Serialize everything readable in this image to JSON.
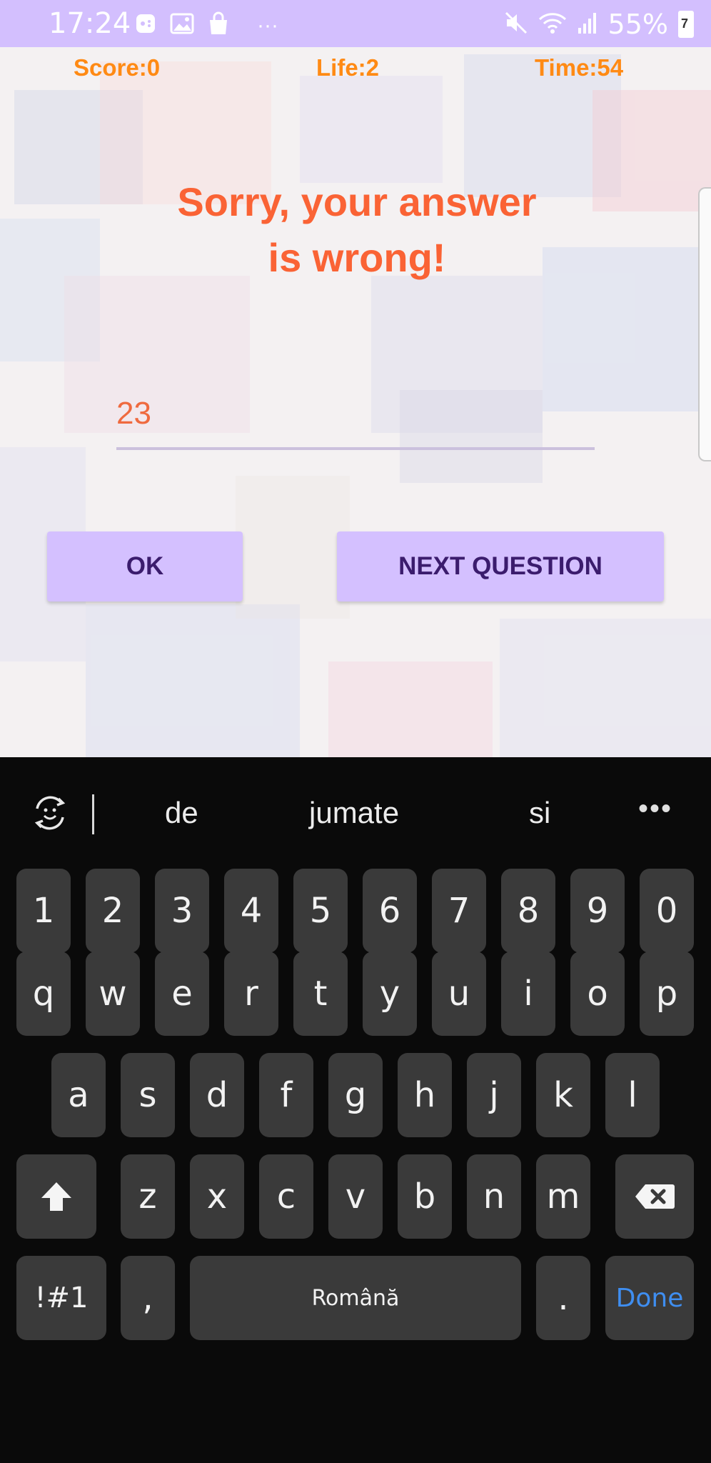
{
  "status_bar": {
    "time": "17:24",
    "notification_icons": [
      "game-icon",
      "image-icon",
      "shopping-bag-icon",
      "more-dots-icon"
    ],
    "more_glyph": "···",
    "battery_percent": "55%",
    "right_icons": [
      "mute-icon",
      "wifi-icon",
      "signal-icon",
      "battery-icon"
    ]
  },
  "hud": {
    "score": "Score:0",
    "life": "Life:2",
    "time": "Time:54",
    "color": "#ff8a14"
  },
  "message": {
    "line1": "Sorry, your answer",
    "line2": "is wrong!",
    "color": "#fa6335"
  },
  "answer": {
    "value": "23"
  },
  "buttons": {
    "ok": "OK",
    "next": "NEXT QUESTION",
    "background": "#d4c0ff"
  },
  "keyboard": {
    "suggestions": [
      "de",
      "jumate",
      "si"
    ],
    "more": "•••",
    "row_numbers": [
      "1",
      "2",
      "3",
      "4",
      "5",
      "6",
      "7",
      "8",
      "9",
      "0"
    ],
    "row1": [
      "q",
      "w",
      "e",
      "r",
      "t",
      "y",
      "u",
      "i",
      "o",
      "p"
    ],
    "row2": [
      "a",
      "s",
      "d",
      "f",
      "g",
      "h",
      "j",
      "k",
      "l"
    ],
    "row3": [
      "z",
      "x",
      "c",
      "v",
      "b",
      "n",
      "m"
    ],
    "shift_icon": "shift-icon",
    "backspace_icon": "backspace-icon",
    "symbols": "!#1",
    "comma": ",",
    "space": "Română",
    "period": ".",
    "done": "Done"
  }
}
